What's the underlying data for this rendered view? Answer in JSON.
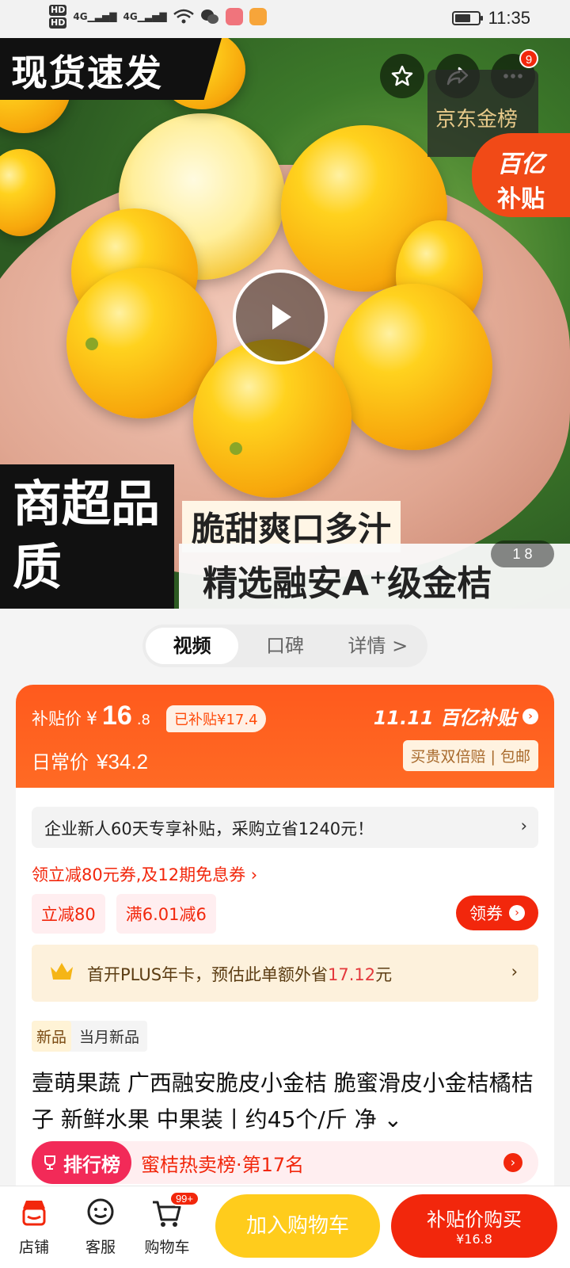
{
  "status": {
    "hd1": "HD",
    "hd2": "HD",
    "net1": "4G",
    "net2": "4G",
    "time": "11:35"
  },
  "hero": {
    "banner_top": "现货速发",
    "badge_count": "9",
    "jd_gold": "京东金榜",
    "subsidy_line1": "百亿",
    "subsidy_line2": "补贴",
    "bottom_left": "商超品质",
    "slogan1": "脆甜爽口多汁",
    "slogan2": "精选融安A⁺级金桔",
    "pager": "1  8"
  },
  "tabs": [
    {
      "label": "视频"
    },
    {
      "label": "口碑"
    },
    {
      "label": "详情 >"
    }
  ],
  "price": {
    "subsidy_label": "补贴价",
    "currency": "¥",
    "subsidy_int": "16",
    "subsidy_dec": ".8",
    "subsidized_tag": "已补贴¥17.4",
    "daily_label": "日常价",
    "daily_value": "¥34.2",
    "event_logo": "11.11 百亿补贴",
    "guarantee": "买贵双倍赔 | 包邮"
  },
  "notice": {
    "text": "企业新人60天专享补贴，采购立省1240元！",
    "arrow": "›"
  },
  "coupon_line": "领立减80元券,及12期免息券 ›",
  "chips": [
    "立减80",
    "满6.01减6"
  ],
  "coupon_button": "领券",
  "plus": {
    "prefix": "首开PLUS年卡，预估此单额外省",
    "amount": "17.12",
    "suffix": "元",
    "arrow": "›"
  },
  "new_tag": {
    "tag": "新品",
    "text": "当月新品"
  },
  "product_title": "壹萌果蔬 广西融安脆皮小金桔 脆蜜滑皮小金桔橘桔子 新鲜水果 中果装丨约45个/斤 净 ⌄",
  "rank": {
    "label": "排行榜",
    "text": "蜜桔热卖榜·第17名"
  },
  "bottombar": {
    "shop": "店铺",
    "service": "客服",
    "cart": "购物车",
    "cart_badge": "99+",
    "add_cart": "加入购物车",
    "buy": "补贴价购买",
    "buy_price": "¥16.8"
  },
  "colors": {
    "accent": "#f2270c",
    "orange": "#ff5a1d",
    "yellow": "#ffcc1c"
  }
}
